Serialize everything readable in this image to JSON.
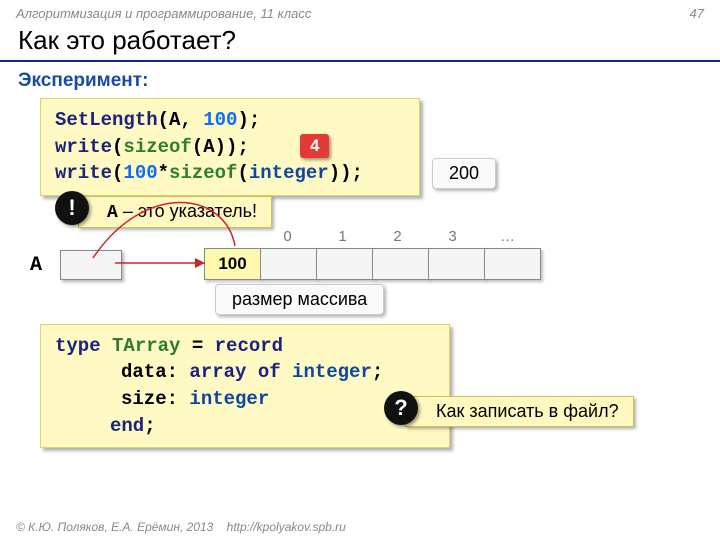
{
  "header": {
    "course": "Алгоритмизация и программирование, 11 класс",
    "page": "47"
  },
  "title": "Как это работает?",
  "subtitle": "Эксперимент:",
  "code1": {
    "l1a": "SetLength",
    "l1b": "(A, ",
    "l1c": "100",
    "l1d": ");",
    "l2a": "write",
    "l2b": "(",
    "l2c": "sizeof",
    "l2d": "(A));",
    "l3a": "write",
    "l3b": "(",
    "l3c": "100",
    "l3d": "*",
    "l3e": "sizeof",
    "l3f": "(",
    "l3g": "integer",
    "l3h": "));"
  },
  "badges": {
    "four": "4",
    "twohundred": "200",
    "pointer": "А – это указатель!",
    "arraysize": "размер массива",
    "question": "Как записать в файл?",
    "excl": "!",
    "qmark": "?"
  },
  "diagram": {
    "var": "A",
    "first": "100",
    "indices": [
      "0",
      "1",
      "2",
      "3",
      "…"
    ]
  },
  "code2": {
    "l1a": "type",
    "l1b": " TArray ",
    "l1c": "= ",
    "l1d": "record",
    "l2a": "data: ",
    "l2b": "array",
    "l2c": " of ",
    "l2d": "integer",
    "l2e": ";",
    "l3a": "size: ",
    "l3b": "integer",
    "l4a": "end",
    "l4b": ";"
  },
  "footer": {
    "copy": "© К.Ю. Поляков, Е.А. Ерёмин, 2013",
    "url": "http://kpolyakov.spb.ru"
  }
}
